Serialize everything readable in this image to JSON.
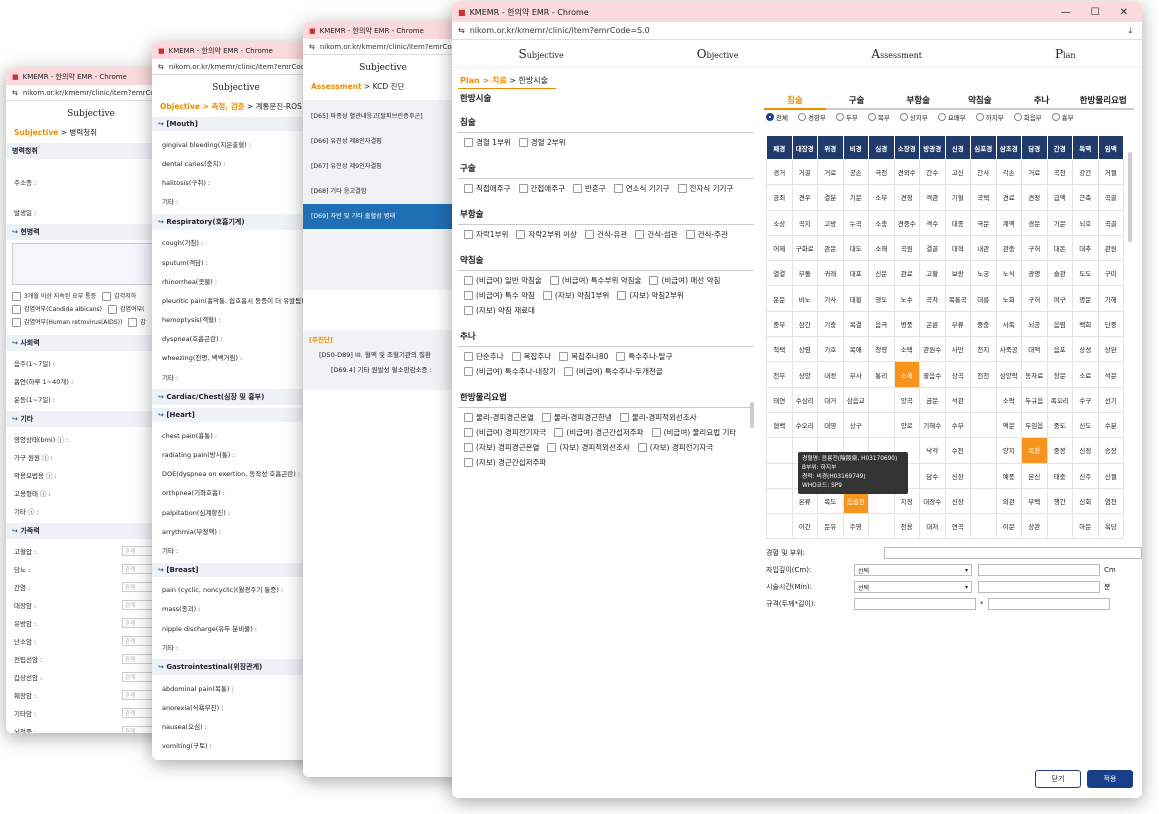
{
  "w1": {
    "title": "KMEMR - 한의약 EMR - Chrome",
    "url": "nikom.or.kr/kmemr/clinic/item?emrCode=S",
    "heading": "Subjective",
    "crumb_a": "Subjective",
    "crumb_b": "병력청취",
    "sec1": "병력청취",
    "f1": "주소증 :",
    "f2": "발생일 :",
    "sec2": "현병력",
    "checks": [
      "3개월 이상 지속된 요부 통증",
      "감각저하",
      "감염여부(Candida albicans)",
      "감염여부(",
      "감염여부(Human retrovirus(AIDS))",
      "감"
    ],
    "sec3": "사회력",
    "soc": [
      "음주(1~7일) :",
      "흡연(하루 1~40개) :",
      "운동(1~7일) :"
    ],
    "sec4": "기타",
    "etc": [
      "영양상태(bmi)",
      "가구 원원",
      "악용요법용",
      "고용형태",
      "기타"
    ],
    "sec5": "가족력",
    "fam": [
      "고혈압 :",
      "당뇨 :",
      "간염 :",
      "대장암 :",
      "유방암 :",
      "난소암 :",
      "전립선암 :",
      "갑상선암 :",
      "췌장암 :",
      "기타암 :",
      "뇌전증 :"
    ],
    "fam_ph": "관계"
  },
  "w2": {
    "title": "KMEMR - 한의약 EMR - Chrome",
    "url": "nikom.or.kr/kmemr/clinic/item?emrCode",
    "heading": "Subjective",
    "crumb_a": "Objective > 측정, 검증",
    "crumb_b": "계통문진-ROS",
    "sections": [
      {
        "h": "[Mouth]",
        "items": [
          "gingival bleeding(치은출혈) :",
          "dental caries(충치) :",
          "halitosis(구취) :",
          "기타 :"
        ]
      },
      {
        "h": "Respiratory(호흡기계)",
        "items": [
          "cough(기침) :",
          "sputum(객담) :",
          "rhinorrhea(콧물) :",
          "pleuritic pain(흉막통, 쉽호흡시 등증이 더 유발됨)",
          "hemoptysis(객혈) :",
          "dyspnea(호흡곤란) :",
          "wheezing(천명, 쌕쌕거림) :",
          "기타 :"
        ]
      },
      {
        "h": "Cardiac/Chest(심장 및 흉부)",
        "items": []
      },
      {
        "h": "[Heart]",
        "items": [
          "chest pain(흉통) :",
          "radiating pain(방사통) :",
          "DOE(dyspnea on exertion, 동작성 호흡곤란) :",
          "orthpnea(기좌호흡) :",
          "palpitation(심계항진) :",
          "arrythmia(부정맥) :",
          "기타 :"
        ]
      },
      {
        "h": "[Breast]",
        "items": [
          "pain (cyclic, noncyclic)(월경주기 통증) :",
          "mass(종괴) :",
          "nipple discharge(유두 분비물) :",
          "기타 :"
        ]
      },
      {
        "h": "Gastrointestinal(위장관계)",
        "items": [
          "abdominal pain(복통) :",
          "anorexia(식욕부진) :",
          "nausea(오심) :",
          "vomiting(구토) :"
        ]
      }
    ]
  },
  "w3": {
    "title": "KMEMR - 한의약 EMR - Chrome",
    "url": "nikom.or.kr/kmemr/clinic/item?emrCod",
    "heading": "Subjective",
    "crumb_a": "Assessment",
    "crumb_b": "KCD 진단",
    "items": [
      "[D65] 파종성 혈관내응고[탈피브린증후군]",
      "[D66] 유전성 제8인자결핍",
      "[D67] 유전성 제9인자결핍",
      "[D68] 기타 응고결함",
      "[D69] 자반 및 기타 출혈성 병태"
    ],
    "dx_label": "[주진단]",
    "dx1": "[D50-D89] III. 혈액 및 조혈기관의 질환",
    "dx2": "[D69.4] 기타 원발성 혈소판감소증 :"
  },
  "w4": {
    "title": "KMEMR - 한의약 EMR - Chrome",
    "url": "nikom.or.kr/kmemr/clinic/item?emrCode=S.0",
    "soap": [
      {
        "c": "S",
        "r": "ubjective"
      },
      {
        "c": "O",
        "r": "bjective"
      },
      {
        "c": "A",
        "r": "ssessment"
      },
      {
        "c": "P",
        "r": "lan"
      }
    ],
    "crumb_a": "Plan > 치료",
    "crumb_b": "한방시술",
    "left_title": "한방시술",
    "cats": [
      {
        "h": "침술",
        "ck": [
          "경혈 1부위",
          "경혈 2부위"
        ]
      },
      {
        "h": "구술",
        "ck": [
          "직접애주구",
          "간접애주구",
          "반흔구",
          "연소식 기기구",
          "전자식 기기구"
        ]
      },
      {
        "h": "부항술",
        "ck": [
          "자락1부위",
          "자락2부위 이상",
          "건식-유관",
          "건식-섬관",
          "건식-주관"
        ]
      },
      {
        "h": "약침술",
        "ck": [
          "(비급여) 일반 약침술",
          "(비급여) 특수부위 약침술",
          "(비급여) 매선 약침",
          "(비급여) 특수 약침",
          "(자보) 약침1부위",
          "(자보) 약침2부위",
          "(자보) 약침 재료대"
        ]
      },
      {
        "h": "추나",
        "ck": [
          "단순추나",
          "복잡추나",
          "복잡추나80",
          "특수추나-탈구",
          "(비급여) 특수추나-내장기",
          "(비급여) 특수추나-두개천골"
        ]
      },
      {
        "h": "한방물리요법",
        "ck": [
          "물리-경피경근온열",
          "물리-경피경근한냉",
          "물리-경피적외선조사",
          "(비급여) 경피전기자극",
          "(비급여) 경근간섭저주파",
          "(비급여) 물리요법 기타",
          "(자보) 경피경근온열",
          "(자보) 경피적외선조사",
          "(자보) 경피전기자극",
          "(자보) 경근간섭저주파"
        ]
      }
    ],
    "tabs": [
      "침술",
      "구술",
      "부항술",
      "약침술",
      "추나",
      "한방물리요법"
    ],
    "radios": [
      "전체",
      "경항부",
      "두부",
      "목부",
      "상지부",
      "요배부",
      "하지부",
      "회음부",
      "흉부"
    ],
    "cols": [
      "폐경",
      "대장경",
      "위경",
      "비경",
      "심경",
      "소장경",
      "방광경",
      "신경",
      "심포경",
      "삼초경",
      "담경",
      "간경",
      "독맥",
      "임맥"
    ],
    "rows": [
      [
        "경거",
        "거골",
        "거료",
        "공손",
        "극천",
        "견외수",
        "간수",
        "고신",
        "간사",
        "각손",
        "거료",
        "곡천",
        "강간",
        "거궐"
      ],
      [
        "공최",
        "견우",
        "결분",
        "기문",
        "소부",
        "견정",
        "격관",
        "기혈",
        "곡택",
        "견료",
        "견정",
        "급맥",
        "근축",
        "곡골"
      ],
      [
        "소상",
        "곡지",
        "고방",
        "누곡",
        "소충",
        "견중수",
        "격수",
        "대종",
        "극문",
        "계맥",
        "경문",
        "기문",
        "뇌호",
        "곡골"
      ],
      [
        "어제",
        "구화료",
        "관문",
        "대도",
        "소해",
        "곡원",
        "결골",
        "대혁",
        "내관",
        "관충",
        "구허",
        "대돈",
        "대추",
        "관원"
      ],
      [
        "열결",
        "부돌",
        "귀래",
        "대포",
        "신문",
        "관료",
        "고황",
        "보랑",
        "노궁",
        "노식",
        "광명",
        "슬관",
        "도도",
        "구미"
      ],
      [
        "운문",
        "비노",
        "기사",
        "대횡",
        "영도",
        "노수",
        "곡차",
        "복통곡",
        "대릉",
        "노회",
        "구허",
        "여구",
        "명문",
        "기해"
      ],
      [
        "중부",
        "삼간",
        "기충",
        "복결",
        "음극",
        "병풍",
        "곤륜",
        "부류",
        "중충",
        "사독",
        "뇌공",
        "음렴",
        "백회",
        "단중"
      ],
      [
        "척택",
        "상렴",
        "기호",
        "복애",
        "청령",
        "소택",
        "관원수",
        "사만",
        "천지",
        "사죽공",
        "대맥",
        "음포",
        "상성",
        "상완"
      ],
      [
        "천부",
        "상양",
        "내정",
        "부사",
        "통리",
        "소해",
        "괄음수",
        "상곡",
        "천천",
        "삼양락",
        "동자료",
        "장문",
        "소료",
        "석문"
      ],
      [
        "태연",
        "수삼리",
        "대거",
        "삼음교",
        "",
        "양곡",
        "금문",
        "석관",
        "",
        "소락",
        "두규음",
        "족오리",
        "수구",
        "선기"
      ],
      [
        "협백",
        "수오리",
        "대영",
        "상구",
        "",
        "양로",
        "기해수",
        "수부",
        "",
        "액문",
        "두임읍",
        "중도",
        "신도",
        "수분"
      ],
      [
        "",
        "",
        "",
        "",
        "",
        "",
        "낙각",
        "수천",
        "",
        "양지",
        "목창",
        "중봉",
        "신정",
        "승장"
      ],
      [
        "",
        "",
        "",
        "",
        "",
        "",
        "담수",
        "신장",
        "",
        "예풍",
        "본신",
        "태충",
        "신주",
        "신궐"
      ],
      [
        "",
        "온류",
        "목도",
        "음릉천",
        "",
        "지정",
        "대장수",
        "신장",
        "",
        "외관",
        "부백",
        "행간",
        "신회",
        "염천"
      ],
      [
        "",
        "이간",
        "둔유",
        "주영",
        "",
        "천용",
        "대저",
        "연곡",
        "",
        "이문",
        "상관",
        "",
        "아문",
        "옥당"
      ]
    ],
    "tooltip": [
      "경혈명: 음릉천(陰陵泉, H03170690)",
      "B부위: 하지부",
      "경락: 비경(H03169749)",
      "WHO코드: SP9"
    ],
    "form": {
      "l1": "경혈 및 부위:",
      "l2": "자입깊이(Cm):",
      "l3": "시술시간(Min):",
      "l4": "규격(두께*길이):",
      "sel": "선택",
      "u1": "Cm",
      "u2": "분",
      "x": "*"
    },
    "btn_close": "닫기",
    "btn_apply": "적용"
  }
}
